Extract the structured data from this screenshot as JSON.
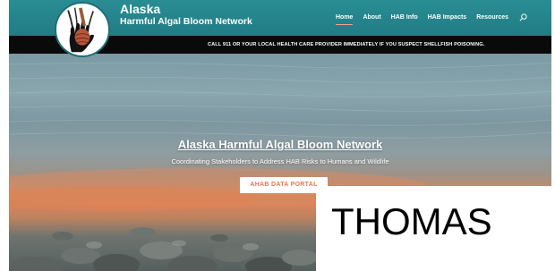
{
  "brand": {
    "name_line1": "Alaska",
    "name_line2": "Harmful Algal Bloom Network",
    "logo_icon": "hand-basket-logo-icon"
  },
  "nav": {
    "items": [
      {
        "label": "Home",
        "active": true
      },
      {
        "label": "About",
        "active": false
      },
      {
        "label": "HAB Info",
        "active": false
      },
      {
        "label": "HAB Impacts",
        "active": false
      },
      {
        "label": "Resources",
        "active": false
      }
    ],
    "search_icon": "search-icon"
  },
  "alert": {
    "text": "CALL 911 OR YOUR LOCAL HEALTH CARE PROVIDER IMMEDIATELY IF YOU SUSPECT SHELLFISH POISONING."
  },
  "hero": {
    "title": "Alaska Harmful Algal Bloom Network",
    "subtitle": "Coordinating Stakeholders to Address HAB Risks to Humans and Wildlife",
    "button_label": "AHAB DATA PORTAL"
  },
  "overlay": {
    "text": "THOMAS"
  },
  "colors": {
    "header_teal": "#25868e",
    "alert_black": "#0a0a0a",
    "nav_active_underline": "#f2a58f",
    "button_text": "#e0785e",
    "algae_orange": "#d6845c"
  }
}
